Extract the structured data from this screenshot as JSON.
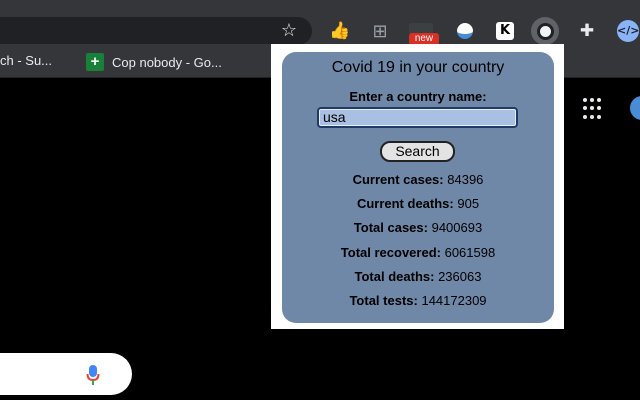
{
  "browser": {
    "bookmarks": [
      {
        "label": "ch - Su..."
      },
      {
        "label": "Cop nobody - Go..."
      }
    ],
    "extensions": {
      "new_badge": "new",
      "k_letter": "K",
      "code_label": "</>"
    }
  },
  "popup": {
    "title": "Covid 19 in your country",
    "prompt": "Enter a country name:",
    "country_value": "usa",
    "search_label": "Search",
    "stats": [
      {
        "label": "Current cases:",
        "value": "84396"
      },
      {
        "label": "Current deaths:",
        "value": "905"
      },
      {
        "label": "Total cases:",
        "value": "9400693"
      },
      {
        "label": "Total recovered:",
        "value": "6061598"
      },
      {
        "label": "Total deaths:",
        "value": "236063"
      },
      {
        "label": "Total tests:",
        "value": "144172309"
      }
    ]
  }
}
